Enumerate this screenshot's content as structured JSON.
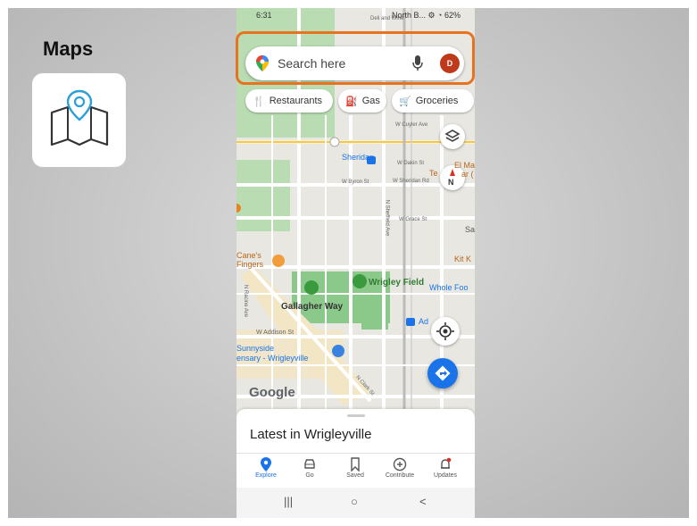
{
  "slide": {
    "title": "Maps"
  },
  "status_bar": {
    "time": "6:31",
    "right": "North B... ⚙ ◔ 62%"
  },
  "search": {
    "placeholder": "Search here",
    "avatar_letter": "D"
  },
  "chips": [
    {
      "label": "Restaurants",
      "icon": "fork-knife-icon"
    },
    {
      "label": "Gas",
      "icon": "gas-pump-icon"
    },
    {
      "label": "Groceries",
      "icon": "cart-icon"
    }
  ],
  "map": {
    "labels": {
      "sheridan": "Sheridan",
      "wrigley_field": "Wrigley Field",
      "whole_foods": "Whole Foo",
      "gallagher_way": "Gallagher Way",
      "canes": "Cane's\nFingers",
      "sunnyside": "Sunnyside\nensary - Wrigleyville",
      "addison": "W Addison St",
      "clark": "N Clark St",
      "sheffield": "N Sheffield Ave",
      "racine": "N Racine Ave",
      "kit": "Kit K",
      "el_ma": "El Ma",
      "te": "Te",
      "ar": "ar (",
      "sa": "Sa",
      "ad": "Ad",
      "cuyler": "W Cuyler Ave",
      "dakin": "W Dakin St",
      "byron": "W Byron St",
      "grace": "W Grace St",
      "sheridan_rd": "W Sheridan Rd",
      "north_fork": "North B...",
      "deli": "Deli and Wine"
    },
    "compass_letter": "N",
    "logo": "Google"
  },
  "sheet": {
    "title": "Latest in Wrigleyville"
  },
  "nav": [
    {
      "label": "Explore",
      "icon": "explore-pin-icon",
      "active": true
    },
    {
      "label": "Go",
      "icon": "car-icon",
      "active": false
    },
    {
      "label": "Saved",
      "icon": "bookmark-icon",
      "active": false
    },
    {
      "label": "Contribute",
      "icon": "add-circle-icon",
      "active": false
    },
    {
      "label": "Updates",
      "icon": "bell-icon",
      "active": false
    }
  ],
  "system_nav": {
    "recents": "|||",
    "home": "○",
    "back": "<"
  },
  "colors": {
    "accent_blue": "#1a73e8",
    "highlight_orange": "#e8731f",
    "park_green": "#b7dcb0",
    "avatar_red": "#c0391b"
  }
}
